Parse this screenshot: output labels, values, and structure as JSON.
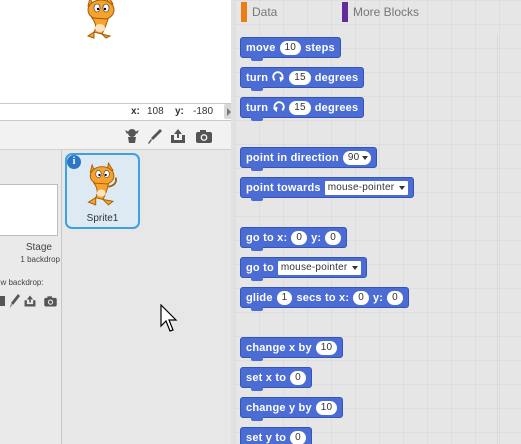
{
  "stage": {
    "x_label": "x:",
    "x_value": "108",
    "y_label": "y:",
    "y_value": "-180"
  },
  "sprite_pane": {
    "stage_label": "Stage",
    "stage_sub": "1 backdrop",
    "new_backdrop_label": "ew backdrop:",
    "sprite_name": "Sprite1"
  },
  "categories": {
    "data": "Data",
    "data_color": "#ee7d16",
    "more": "More Blocks",
    "more_color": "#632d99"
  },
  "blocks": {
    "move": {
      "label": "move",
      "value": "10",
      "suffix": "steps"
    },
    "turn_right": {
      "label": "turn",
      "value": "15",
      "suffix": "degrees"
    },
    "turn_left": {
      "label": "turn",
      "value": "15",
      "suffix": "degrees"
    },
    "point_direction": {
      "label": "point in direction",
      "value": "90"
    },
    "point_towards": {
      "label": "point towards",
      "value": "mouse-pointer"
    },
    "go_to_xy": {
      "label": "go to x:",
      "x": "0",
      "y_label": "y:",
      "y": "0"
    },
    "go_to": {
      "label": "go to",
      "value": "mouse-pointer"
    },
    "glide": {
      "label": "glide",
      "secs": "1",
      "mid": "secs to x:",
      "x": "0",
      "y_label": "y:",
      "y": "0"
    },
    "change_x": {
      "label": "change x by",
      "value": "10"
    },
    "set_x": {
      "label": "set x to",
      "value": "0"
    },
    "change_y": {
      "label": "change y by",
      "value": "10"
    },
    "set_y": {
      "label": "set y to",
      "value": "0"
    }
  },
  "colors": {
    "motion_block": "#4a6cd4",
    "selected_border": "#3da0e0"
  }
}
